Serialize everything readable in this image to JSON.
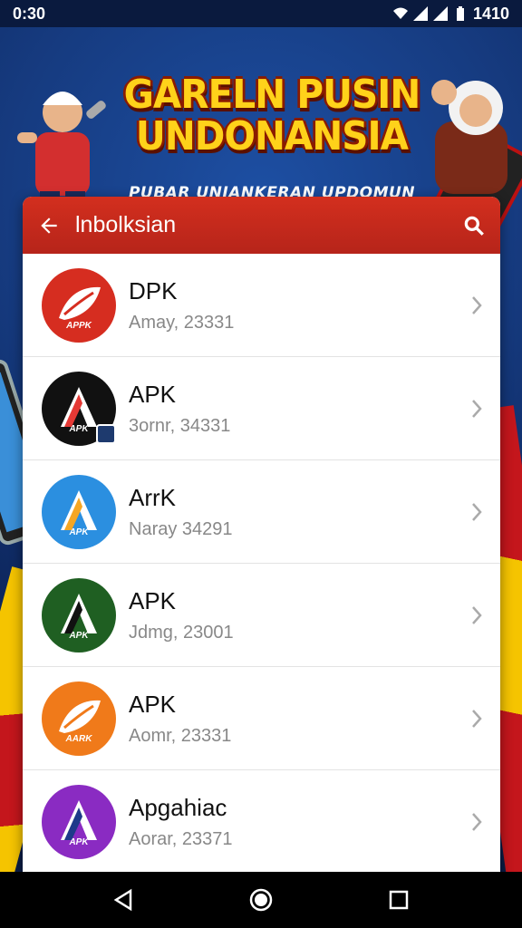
{
  "status_bar": {
    "time": "0:30",
    "clock_right": "1410",
    "icons": [
      "wifi-icon",
      "signal-icon",
      "signal-icon",
      "battery-icon"
    ]
  },
  "banner": {
    "title_line1": "GARELN PUSIN",
    "title_line2": "UNDONANSIA",
    "subtitle": "PUBAR UNIANKERAN UPDOMUN"
  },
  "app_bar": {
    "title": "lnbolksian",
    "back_icon": "arrow-left-icon",
    "search_icon": "search-icon",
    "color": "#c62a1c"
  },
  "apps": [
    {
      "name": "DPK",
      "meta": "Amay, 23331",
      "icon_color": "#d62d20",
      "glyph": "leaf",
      "icon_label": "APPK"
    },
    {
      "name": "APK",
      "meta": "3ornr, 34331",
      "icon_color": "#111111",
      "glyph": "A",
      "icon_label": "APK"
    },
    {
      "name": "ArrK",
      "meta": "Naray 34291",
      "icon_color": "#2b8fe0",
      "glyph": "A",
      "icon_label": "APK"
    },
    {
      "name": "APK",
      "meta": "Jdmg, 23001",
      "icon_color": "#1f5f22",
      "glyph": "A",
      "icon_label": "APK"
    },
    {
      "name": "APK",
      "meta": "Aomr, 23331",
      "icon_color": "#f07a1a",
      "glyph": "leaf",
      "icon_label": "AARK"
    },
    {
      "name": "Apgahiac",
      "meta": "Aorar, 23371",
      "icon_color": "#8a2bc2",
      "glyph": "A",
      "icon_label": "APK"
    }
  ]
}
